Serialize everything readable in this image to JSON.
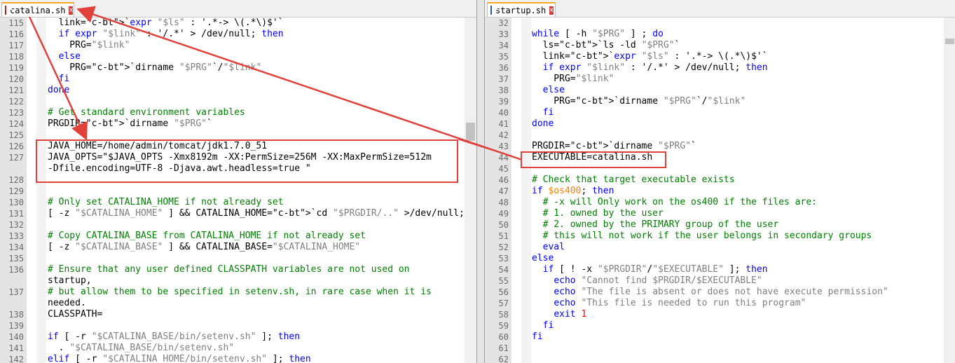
{
  "left_tab": {
    "title": "catalina.sh",
    "close": "x"
  },
  "right_tab": {
    "title": "startup.sh",
    "close": "x"
  },
  "left_lines": [
    {
      "n": "115",
      "t": "  link=`expr \"$ls\" : '.*-> \\(.*\\)$'`"
    },
    {
      "n": "116",
      "t": "  if expr \"$link\" : '/.*' > /dev/null; then"
    },
    {
      "n": "117",
      "t": "    PRG=\"$link\""
    },
    {
      "n": "118",
      "t": "  else"
    },
    {
      "n": "119",
      "t": "    PRG=`dirname \"$PRG\"`/\"$link\""
    },
    {
      "n": "120",
      "t": "  fi"
    },
    {
      "n": "121",
      "t": "done"
    },
    {
      "n": "122",
      "t": ""
    },
    {
      "n": "123",
      "t": "# Get standard environment variables"
    },
    {
      "n": "124",
      "t": "PRGDIR=`dirname \"$PRG\"`"
    },
    {
      "n": "125",
      "t": ""
    },
    {
      "n": "126",
      "t": "JAVA_HOME=/home/admin/tomcat/jdk1.7.0_51"
    },
    {
      "n": "127",
      "t": "JAVA_OPTS=\"$JAVA_OPTS -Xmx8192m -XX:PermSize=256M -XX:MaxPermSize=512m"
    },
    {
      "n": "",
      "t": "-Dfile.encoding=UTF-8 -Djava.awt.headless=true \""
    },
    {
      "n": "128",
      "t": ""
    },
    {
      "n": "129",
      "t": ""
    },
    {
      "n": "130",
      "t": "# Only set CATALINA_HOME if not already set"
    },
    {
      "n": "131",
      "t": "[ -z \"$CATALINA_HOME\" ] && CATALINA_HOME=`cd \"$PRGDIR/..\" >/dev/null; pwd`"
    },
    {
      "n": "132",
      "t": ""
    },
    {
      "n": "133",
      "t": "# Copy CATALINA_BASE from CATALINA_HOME if not already set"
    },
    {
      "n": "134",
      "t": "[ -z \"$CATALINA_BASE\" ] && CATALINA_BASE=\"$CATALINA_HOME\""
    },
    {
      "n": "135",
      "t": ""
    },
    {
      "n": "136",
      "t": "# Ensure that any user defined CLASSPATH variables are not used on"
    },
    {
      "n": "",
      "t": "startup,"
    },
    {
      "n": "137",
      "t": "# but allow them to be specified in setenv.sh, in rare case when it is"
    },
    {
      "n": "",
      "t": "needed."
    },
    {
      "n": "138",
      "t": "CLASSPATH="
    },
    {
      "n": "139",
      "t": ""
    },
    {
      "n": "140",
      "t": "if [ -r \"$CATALINA_BASE/bin/setenv.sh\" ]; then"
    },
    {
      "n": "141",
      "t": "  . \"$CATALINA_BASE/bin/setenv.sh\""
    },
    {
      "n": "142",
      "t": "elif [ -r \"$CATALINA_HOME/bin/setenv.sh\" ]; then"
    }
  ],
  "right_lines": [
    {
      "n": "32",
      "t": ""
    },
    {
      "n": "33",
      "t": "while [ -h \"$PRG\" ] ; do"
    },
    {
      "n": "34",
      "t": "  ls=`ls -ld \"$PRG\"`"
    },
    {
      "n": "35",
      "t": "  link=`expr \"$ls\" : '.*-> \\(.*\\)$'`"
    },
    {
      "n": "36",
      "t": "  if expr \"$link\" : '/.*' > /dev/null; then"
    },
    {
      "n": "37",
      "t": "    PRG=\"$link\""
    },
    {
      "n": "38",
      "t": "  else"
    },
    {
      "n": "39",
      "t": "    PRG=`dirname \"$PRG\"`/\"$link\""
    },
    {
      "n": "40",
      "t": "  fi"
    },
    {
      "n": "41",
      "t": "done"
    },
    {
      "n": "42",
      "t": ""
    },
    {
      "n": "43",
      "t": "PRGDIR=`dirname \"$PRG\"`"
    },
    {
      "n": "44",
      "t": "EXECUTABLE=catalina.sh"
    },
    {
      "n": "45",
      "t": ""
    },
    {
      "n": "46",
      "t": "# Check that target executable exists"
    },
    {
      "n": "47",
      "t": "if $os400; then"
    },
    {
      "n": "48",
      "t": "  # -x will Only work on the os400 if the files are:"
    },
    {
      "n": "49",
      "t": "  # 1. owned by the user"
    },
    {
      "n": "50",
      "t": "  # 2. owned by the PRIMARY group of the user"
    },
    {
      "n": "51",
      "t": "  # this will not work if the user belongs in secondary groups"
    },
    {
      "n": "52",
      "t": "  eval"
    },
    {
      "n": "53",
      "t": "else"
    },
    {
      "n": "54",
      "t": "  if [ ! -x \"$PRGDIR\"/\"$EXECUTABLE\" ]; then"
    },
    {
      "n": "55",
      "t": "    echo \"Cannot find $PRGDIR/$EXECUTABLE\""
    },
    {
      "n": "56",
      "t": "    echo \"The file is absent or does not have execute permission\""
    },
    {
      "n": "57",
      "t": "    echo \"This file is needed to run this program\""
    },
    {
      "n": "58",
      "t": "    exit 1"
    },
    {
      "n": "59",
      "t": "  fi"
    },
    {
      "n": "60",
      "t": "fi"
    },
    {
      "n": "61",
      "t": ""
    },
    {
      "n": "62",
      "t": ""
    }
  ]
}
